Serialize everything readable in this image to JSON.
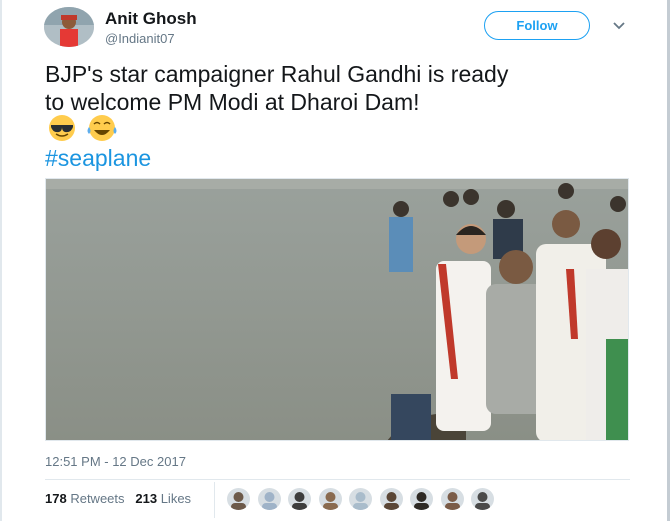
{
  "tweet": {
    "author_name": "Anit Ghosh",
    "author_handle": "@Indianit07",
    "follow_label": "Follow",
    "text_line1": "BJP's star campaigner Rahul Gandhi is ready",
    "text_line2": "to welcome PM Modi at Dharoi Dam!",
    "emojis": [
      "sunglasses-face",
      "tears-of-joy-face"
    ],
    "hashtag": "#seaplane",
    "timestamp": "12:51 PM - 12 Dec 2017",
    "retweets_count": "178",
    "retweets_label": "Retweets",
    "likes_count": "213",
    "likes_label": "Likes",
    "liker_avatar_count": 9
  },
  "colors": {
    "brand_blue": "#1da1f2",
    "hashtag": "#1b95e0",
    "secondary_text": "#657786",
    "divider": "#e1e8ed"
  }
}
